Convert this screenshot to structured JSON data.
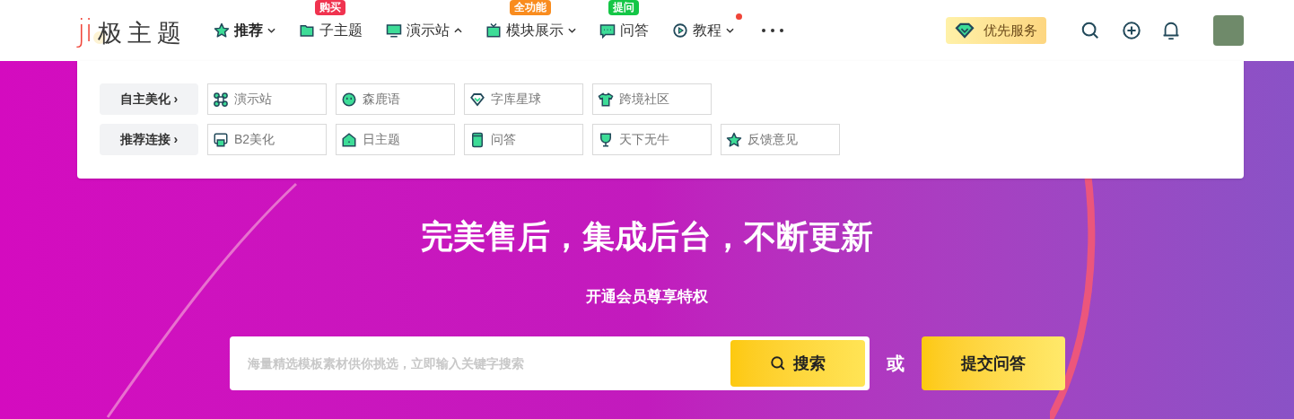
{
  "logo": {
    "mark": "ji",
    "text": "极主题"
  },
  "nav": [
    {
      "label": "推荐",
      "selected": true,
      "expanded": false,
      "dot": false
    },
    {
      "label": "子主题",
      "selected": false,
      "badge": {
        "label": "购买",
        "color": "#f0334f"
      },
      "dot": false
    },
    {
      "label": "演示站",
      "selected": false,
      "expanded": true,
      "dot": false
    },
    {
      "label": "模块展示",
      "selected": false,
      "badge": {
        "label": "全功能",
        "color": "#f98c1e"
      },
      "expanded": false,
      "dot": false
    },
    {
      "label": "问答",
      "selected": false,
      "badge": {
        "label": "提问",
        "color": "#14c646"
      },
      "dot": false
    },
    {
      "label": "教程",
      "selected": false,
      "expanded": false,
      "dot": true
    }
  ],
  "vip_button": "优先服务",
  "dropdown": [
    {
      "label": "自主美化 ›",
      "links": [
        "演示站",
        "森鹿语",
        "字库星球",
        "跨境社区"
      ]
    },
    {
      "label": "推荐连接 ›",
      "links": [
        "B2美化",
        "日主题",
        "问答",
        "天下无牛",
        "反馈意见"
      ]
    }
  ],
  "hero": {
    "title": "完美售后，集成后台，不断更新",
    "subtitle": "开通会员尊享特权",
    "search": {
      "placeholder": "海量精选模板素材供你挑选，立即输入关键字搜索",
      "button": "搜索"
    },
    "or": "或",
    "ask_button": "提交问答"
  }
}
